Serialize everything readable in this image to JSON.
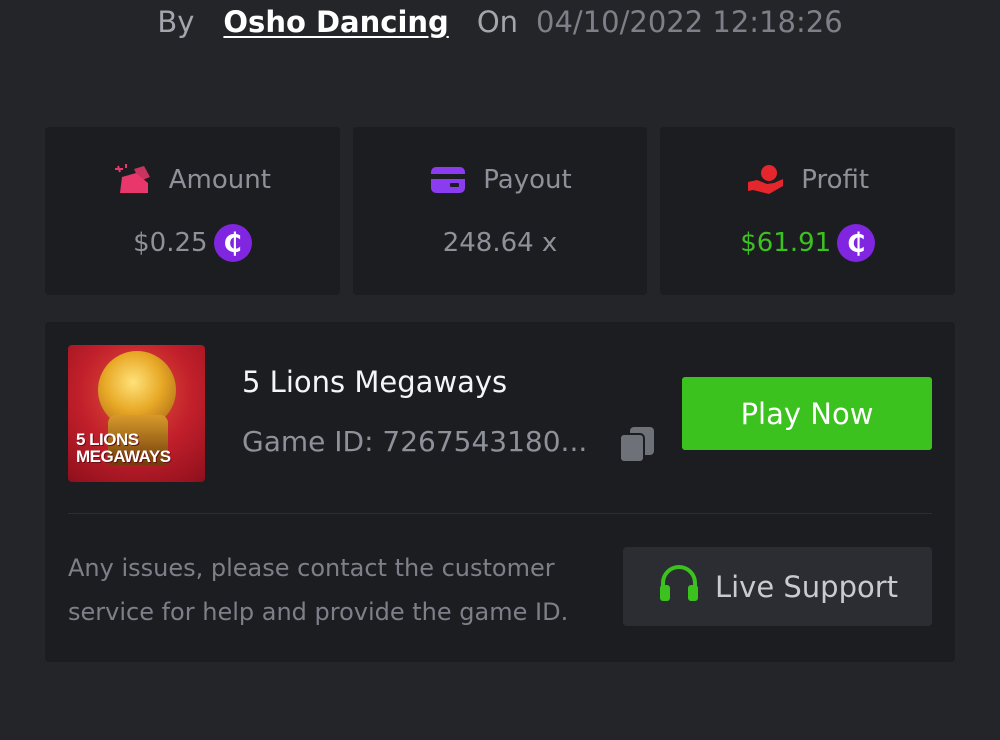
{
  "byline": {
    "by_label": "By",
    "author": "Osho Dancing",
    "on_label": "On",
    "datetime": "04/10/2022 12:18:26"
  },
  "stats": {
    "amount": {
      "label": "Amount",
      "value": "$0.25",
      "icon": "bet-amount-icon",
      "coin": "₵"
    },
    "payout": {
      "label": "Payout",
      "value": "248.64 x",
      "icon": "card-icon"
    },
    "profit": {
      "label": "Profit",
      "value": "$61.91",
      "icon": "hand-coin-icon",
      "coin": "₵"
    }
  },
  "game": {
    "thumb_text_1": "5 LIONS",
    "thumb_text_2": "MEGAWAYS",
    "title": "5 Lions Megaways",
    "id_text": "Game ID: 7267543180...",
    "play_label": "Play Now"
  },
  "support": {
    "help_text": "Any issues, please contact the customer service for help and provide the game ID.",
    "button_label": "Live Support"
  },
  "colors": {
    "background": "#242529",
    "card": "#1c1d21",
    "accent_green": "#3cc21f",
    "coin_purple": "#8126e0",
    "amount_icon": "#e8376b",
    "payout_icon": "#8b3cf0",
    "profit_icon": "#e5262c"
  }
}
